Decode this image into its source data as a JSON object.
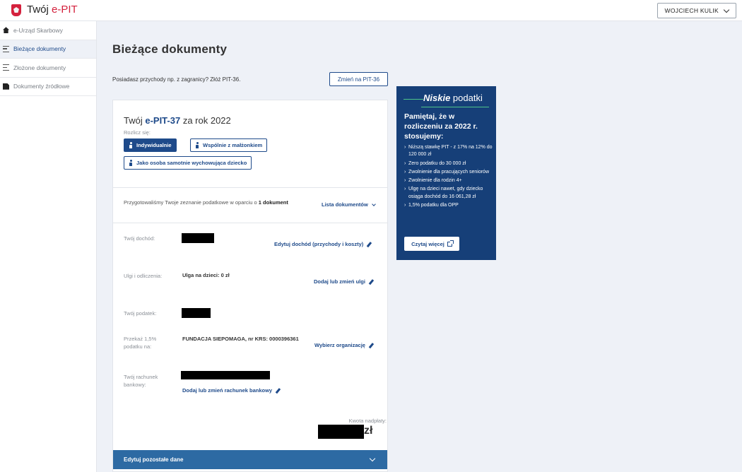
{
  "header": {
    "logo_part1": "Twój ",
    "logo_part2": "e-PIT",
    "user_name": "WOJCIECH KULIK"
  },
  "sidebar": {
    "items": [
      {
        "label": "e-Urząd Skarbowy",
        "icon": "home-icon"
      },
      {
        "label": "Bieżące dokumenty",
        "icon": "list-icon",
        "active": true
      },
      {
        "label": "Złożone dokumenty",
        "icon": "list-check-icon"
      },
      {
        "label": "Dokumenty źródłowe",
        "icon": "document-icon"
      }
    ]
  },
  "main": {
    "title": "Bieżące dokumenty",
    "foreign_income_text": "Posiadasz przychody np. z zagranicy? Złóż PIT-36.",
    "change_pit36_label": "Zmień na PIT-36",
    "card": {
      "title_prefix": "Twój ",
      "title_form_a": "e-PIT-",
      "title_form_b": "37",
      "title_suffix": " za rok 2022",
      "settle_label": "Rozlicz się:",
      "options": {
        "individual": "Indywidualnie",
        "spouse": "Wspólnie z małżonkiem",
        "single_parent": "Jako osoba samotnie wychowująca dziecko"
      },
      "prepared_text": "Przygotowaliśmy Twoje zeznanie podatkowe w oparciu o ",
      "prepared_bold": "1 dokument",
      "documents_list_link": "Lista dokumentów",
      "income_label": "Twój dochód:",
      "income_edit_link": "Edytuj dochód (przychody i koszty)",
      "reliefs_label": "Ulgi i odliczenia:",
      "reliefs_value": "Ulga na dzieci: 0 zł",
      "reliefs_link": "Dodaj lub zmień ulgi",
      "tax_label": "Twój podatek:",
      "donation_label_1": "Przekaż 1,5%",
      "donation_label_2": "podatku na:",
      "donation_value": "FUNDACJA SIEPOMAGA, nr KRS: 0000396361",
      "donation_link": "Wybierz organizację",
      "bank_label_1": "Twój rachunek",
      "bank_label_2": "bankowy:",
      "bank_link": "Dodaj lub zmień rachunek bankowy",
      "refund_label": "Kwota nadpłaty:",
      "refund_unit": "zł",
      "edit_other_data": "Edytuj pozostałe dane"
    }
  },
  "promo": {
    "brand_bold": "Niskie",
    "brand_rest": " podatki",
    "heading": "Pamiętaj, że w rozliczeniu za 2022 r. stosujemy:",
    "items": [
      "Niższą stawkę PIT - z 17% na 12% do 120 000 zł",
      "Zero podatku do 30 000 zł",
      "Zwolnienie dla pracujących seniorów",
      "Zwolnienie dla rodzin 4+",
      "Ulgę na dzieci nawet, gdy dziecko osiąga dochód do 16 061,28 zł",
      "1,5% podatku dla OPP"
    ],
    "read_more": "Czytaj więcej"
  },
  "colors": {
    "primary": "#1e4a8a",
    "accent_red": "#d4213d",
    "promo_bg": "#163f78",
    "bottom_bar": "#2d6aa3"
  }
}
